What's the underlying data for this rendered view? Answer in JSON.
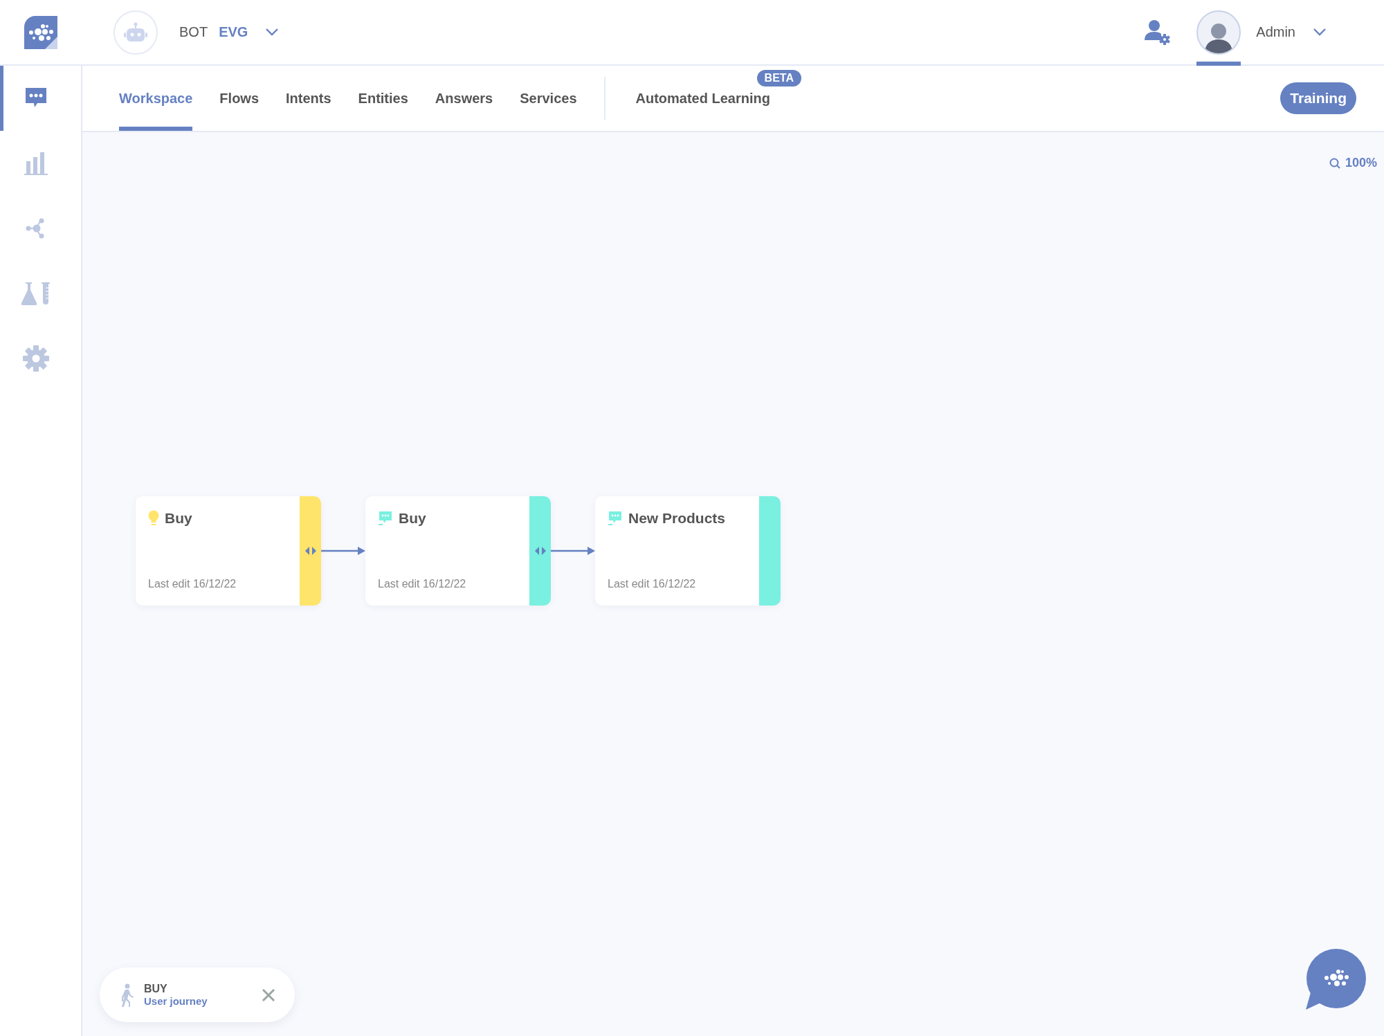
{
  "header": {
    "bot_label": "BOT",
    "bot_name": "EVG",
    "user_name": "Admin"
  },
  "sidebar": {
    "items": [
      {
        "kind": "chat",
        "selected": true
      },
      {
        "kind": "stats",
        "selected": false
      },
      {
        "kind": "graph",
        "selected": false
      },
      {
        "kind": "lab",
        "selected": false
      },
      {
        "kind": "settings",
        "selected": false
      }
    ]
  },
  "tabs": [
    {
      "label": "Workspace",
      "selected": true
    },
    {
      "label": "Flows",
      "selected": false
    },
    {
      "label": "Intents",
      "selected": false
    },
    {
      "label": "Entities",
      "selected": false
    },
    {
      "label": "Answers",
      "selected": false
    },
    {
      "label": "Services",
      "selected": false
    },
    {
      "label": "Automated Learning",
      "selected": false,
      "badge": "BETA"
    }
  ],
  "training_button": "Training",
  "zoom": "100%",
  "nodes": [
    {
      "kind": "intent",
      "title": "Buy",
      "meta": "Last edit 16/12/22",
      "color": "#ffe46b",
      "has_output": true
    },
    {
      "kind": "answer",
      "title": "Buy",
      "meta": "Last edit 16/12/22",
      "color": "#7af0e0",
      "has_output": true
    },
    {
      "kind": "answer",
      "title": "New Products",
      "meta": "Last edit 16/12/22",
      "color": "#7af0e0",
      "has_output": false
    }
  ],
  "journey": {
    "title": "BUY",
    "subtitle": "User journey"
  }
}
